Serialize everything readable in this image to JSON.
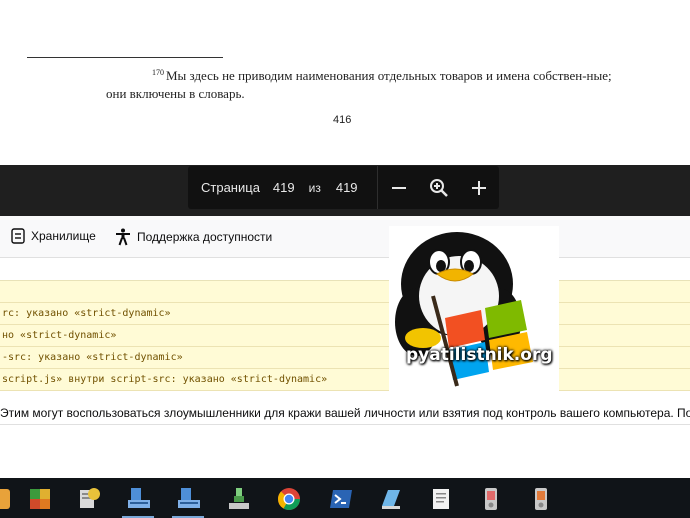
{
  "pdf": {
    "footnote_number": "170",
    "footnote_text": "Мы здесь не приводим наименования отдельных товаров и имена собствен-ные; они включены в словарь.",
    "page_number": "416"
  },
  "viewer": {
    "page_label": "Страница",
    "current_page": "419",
    "of_label": "из",
    "total_pages": "419"
  },
  "devtools": {
    "tabs": [
      {
        "label": "Хранилище",
        "icon": "storage-icon"
      },
      {
        "label": "Поддержка доступности",
        "icon": "accessibility-icon"
      }
    ],
    "warnings": [
      "rc: указано «strict-dynamic»",
      "но «strict-dynamic»",
      "-src: указано «strict-dynamic»",
      " script.js» внутри script-src: указано «strict-dynamic»"
    ],
    "console_message": "Этим могут воспользоваться злоумышленники для кражи вашей личности или взятия под контроль вашего компьютера. Пож"
  },
  "watermark": {
    "text": "pyatilistnik.org",
    "icon": "tux-penguin-windows-logo"
  },
  "taskbar": {
    "icons": [
      "partial-app-icon",
      "colored-squares-app-icon",
      "server-manager-icon",
      "network-computer-icon",
      "network-computer-icon-2",
      "usb-network-icon",
      "chrome-icon",
      "powershell-icon",
      "office-app-icon",
      "notepad-document-icon",
      "media-device-icon",
      "media-device-icon-2"
    ]
  }
}
